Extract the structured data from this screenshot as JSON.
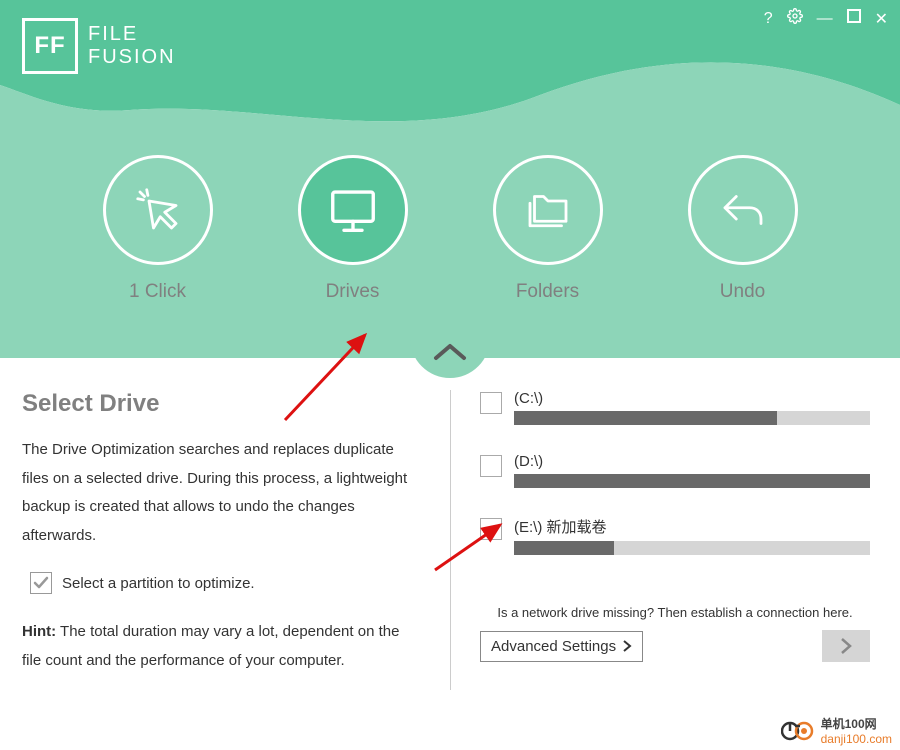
{
  "app": {
    "logo_letters": "FF",
    "title_line1": "FILE",
    "title_line2": "FUSION"
  },
  "window_controls": {
    "help": "?",
    "minimize": "—",
    "close": "✕"
  },
  "modes": {
    "click": "1 Click",
    "drives": "Drives",
    "folders": "Folders",
    "undo": "Undo"
  },
  "left": {
    "heading": "Select Drive",
    "description": "The Drive Optimization searches and replaces duplicate files on a selected drive. During this process, a lightweight backup is created that allows to undo the changes afterwards.",
    "checkbox_label": "Select a partition to optimize.",
    "hint_label": "Hint:",
    "hint_text": " The total duration may vary a lot, dependent on the file count and the performance of your computer."
  },
  "drives": [
    {
      "label": "(C:\\)",
      "fill_pct": 74
    },
    {
      "label": "(D:\\)",
      "fill_pct": 100
    },
    {
      "label": "(E:\\) 新加载卷",
      "fill_pct": 28
    }
  ],
  "right": {
    "network_hint": "Is a network drive missing? Then establish a connection here.",
    "advanced_label": "Advanced Settings"
  },
  "watermark": {
    "site_name": "单机100网",
    "site_url": "danji100.com"
  }
}
